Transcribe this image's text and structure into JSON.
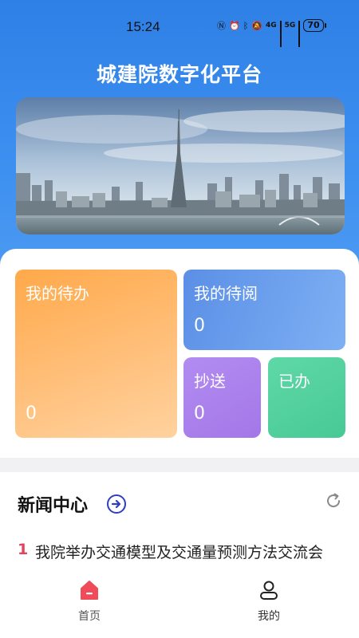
{
  "status_bar": {
    "time": "15:24",
    "network_4g": "4G",
    "network_5g": "5G",
    "battery": "70"
  },
  "header": {
    "title": "城建院数字化平台"
  },
  "banner": {
    "image": "city-skyline-canton-tower"
  },
  "tasks": {
    "todo": {
      "label": "我的待办",
      "count": "0"
    },
    "to_read": {
      "label": "我的待阅",
      "count": "0"
    },
    "cc": {
      "label": "抄送",
      "count": "0"
    },
    "done": {
      "label": "已办"
    }
  },
  "news": {
    "title": "新闻中心",
    "items": [
      {
        "num": "1",
        "text": "我院举办交通模型及交通量预测方法交流会"
      }
    ]
  },
  "tabbar": {
    "home": "首页",
    "mine": "我的"
  },
  "colors": {
    "primary": "#2f80e6",
    "todo": "#ffa94a",
    "read": "#5b8fe6",
    "cc": "#a477e8",
    "done": "#47c996",
    "accent": "#e0455a"
  }
}
